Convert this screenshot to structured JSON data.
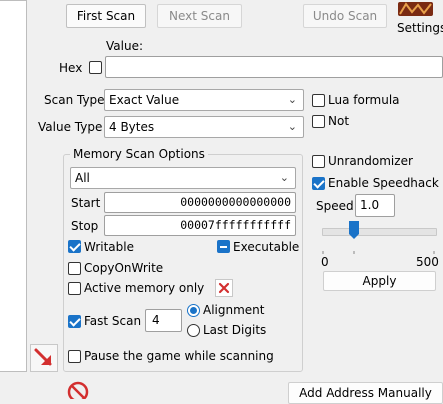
{
  "toolbar": {
    "first_scan": "First Scan",
    "next_scan": "Next Scan",
    "undo_scan": "Undo Scan",
    "settings": "Settings"
  },
  "value": {
    "label": "Value:",
    "hex_label": "Hex",
    "input_value": ""
  },
  "scan_type": {
    "label": "Scan Type",
    "selected": "Exact Value"
  },
  "value_type": {
    "label": "Value Type",
    "selected": "4 Bytes"
  },
  "options_right": {
    "lua_formula": "Lua formula",
    "not": "Not",
    "unrandomizer": "Unrandomizer",
    "enable_speedhack": "Enable Speedhack",
    "speed_label": "Speed",
    "speed_value": "1.0",
    "slider_min": "0",
    "slider_max": "500",
    "slider_value": 1.0,
    "apply": "Apply"
  },
  "memory_scan": {
    "title": "Memory Scan Options",
    "region": "All",
    "start_label": "Start",
    "start_value": "0000000000000000",
    "stop_label": "Stop",
    "stop_value": "00007fffffffffff",
    "writable": "Writable",
    "executable": "Executable",
    "copy_on_write": "CopyOnWrite",
    "active_memory_only": "Active memory only",
    "fast_scan": "Fast Scan",
    "fast_scan_value": "4",
    "alignment": "Alignment",
    "last_digits": "Last Digits",
    "pause_game": "Pause the game while scanning"
  },
  "bottom": {
    "add_address_manually": "Add Address Manually"
  },
  "colors": {
    "accent": "#1a73c8",
    "danger": "#d32f2f"
  }
}
